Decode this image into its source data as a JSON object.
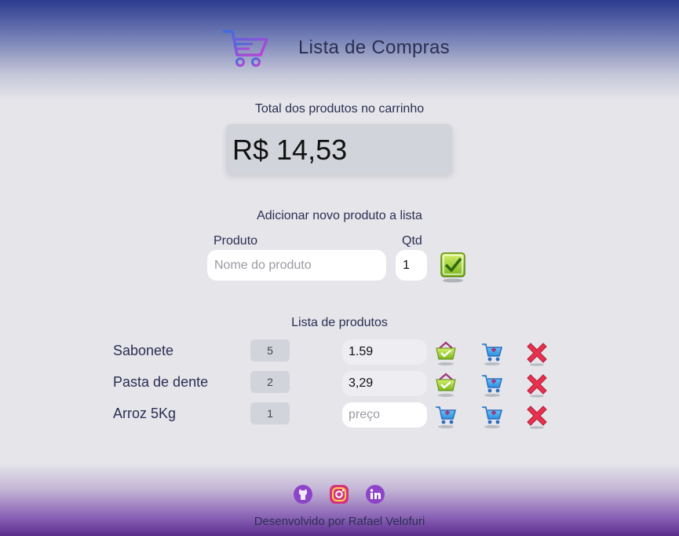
{
  "header": {
    "title": "Lista de Compras",
    "logo_icon": "shopping-cart-icon"
  },
  "total": {
    "label": "Total dos produtos no carrinho",
    "value": "R$ 14,53"
  },
  "add_form": {
    "heading": "Adicionar novo produto a lista",
    "product_label": "Produto",
    "product_placeholder": "Nome do produto",
    "qty_label": "Qtd",
    "qty_value": "1",
    "confirm_icon": "check-icon"
  },
  "list": {
    "heading": "Lista de produtos",
    "price_placeholder": "preço",
    "items": [
      {
        "name": "Sabonete",
        "qty": "5",
        "price": "1.59",
        "status_icon": "basket-check-icon"
      },
      {
        "name": "Pasta de dente",
        "qty": "2",
        "price": "3,29",
        "status_icon": "basket-check-icon"
      },
      {
        "name": "Arroz 5Kg",
        "qty": "1",
        "price": "",
        "status_icon": "cart-add-icon"
      }
    ]
  },
  "footer": {
    "credit": "Desenvolvido por Rafael Velofuri",
    "social_icons": [
      "github-icon",
      "instagram-icon",
      "linkedin-icon"
    ]
  },
  "colors": {
    "accent": "#2c3a8f",
    "footer": "#5a2c8c",
    "text": "#2b2f52",
    "delete": "#e8314f",
    "confirm": "#8cc63f"
  }
}
